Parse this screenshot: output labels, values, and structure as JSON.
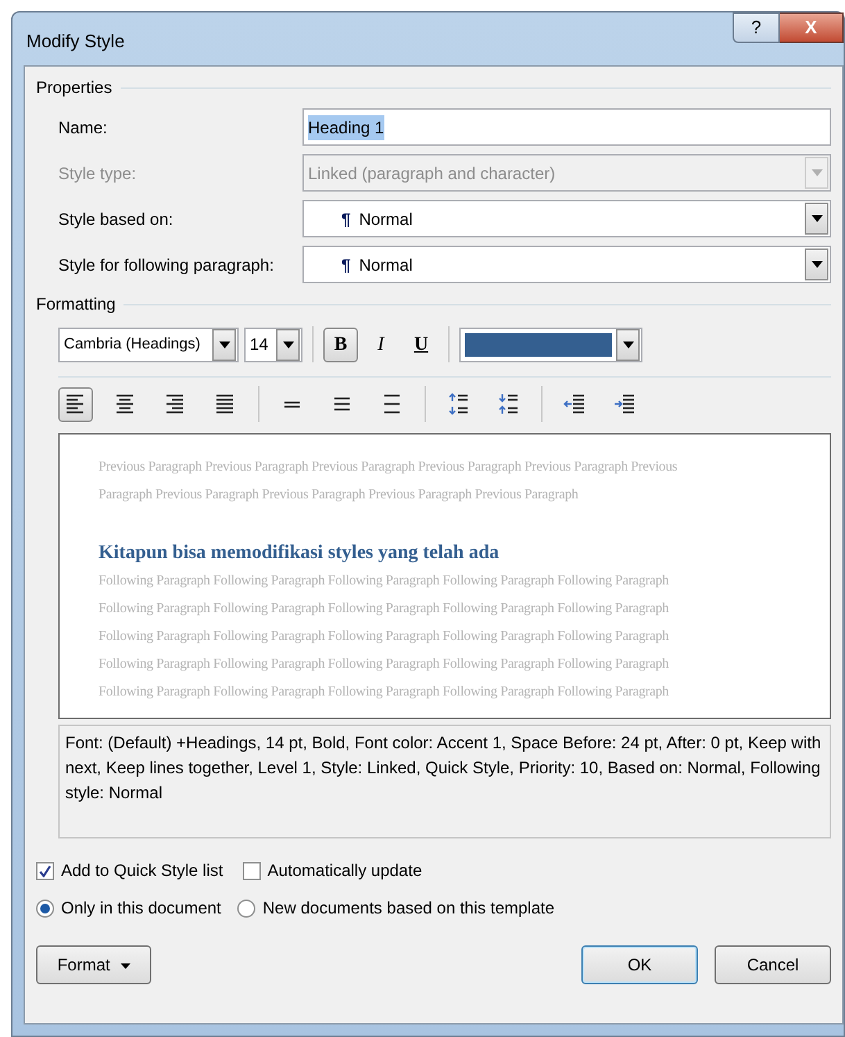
{
  "window": {
    "title": "Modify Style",
    "help_button": "?",
    "close_button": "X"
  },
  "properties": {
    "heading": "Properties",
    "fields": [
      {
        "label": "Name:",
        "kind": "text",
        "value": "Heading 1",
        "disabled": false,
        "selected": true
      },
      {
        "label": "Style type:",
        "kind": "combo",
        "value": "Linked (paragraph and character)",
        "disabled": true
      },
      {
        "label": "Style based on:",
        "kind": "combo",
        "mark": "¶",
        "value": "Normal",
        "disabled": false
      },
      {
        "label": "Style for following paragraph:",
        "kind": "combo",
        "mark": "¶",
        "value": "Normal",
        "disabled": false
      }
    ]
  },
  "formatting": {
    "heading": "Formatting",
    "font": "Cambria (Headings)",
    "size": "14",
    "font_color": {
      "color": "#345f90"
    },
    "style_buttons": [
      {
        "label": "B",
        "kind": "bold",
        "selected": true
      },
      {
        "label": "I",
        "kind": "italic",
        "selected": false
      },
      {
        "label": "U",
        "kind": "underline",
        "selected": false
      }
    ],
    "paragraph_buttons": [
      {
        "kind": "align-left",
        "selected": true
      },
      {
        "kind": "align-center",
        "selected": false
      },
      {
        "kind": "align-right",
        "selected": false
      },
      {
        "kind": "justify",
        "selected": false
      },
      {
        "kind": "sep"
      },
      {
        "kind": "single",
        "selected": false
      },
      {
        "kind": "one-half",
        "selected": false
      },
      {
        "kind": "double",
        "selected": false
      },
      {
        "kind": "sep"
      },
      {
        "kind": "space-up",
        "selected": false
      },
      {
        "kind": "space-down",
        "selected": false
      },
      {
        "kind": "sep"
      },
      {
        "kind": "outdent",
        "selected": false
      },
      {
        "kind": "indent",
        "selected": false
      }
    ]
  },
  "preview": {
    "previous": [
      "Previous Paragraph Previous Paragraph Previous Paragraph Previous Paragraph Previous Paragraph Previous",
      "Paragraph Previous Paragraph Previous Paragraph Previous Paragraph Previous Paragraph"
    ],
    "heading": "Kitapun bisa memodifikasi styles yang telah ada",
    "following": [
      "Following Paragraph Following Paragraph Following Paragraph Following Paragraph Following Paragraph",
      "Following Paragraph Following Paragraph Following Paragraph Following Paragraph Following Paragraph",
      "Following Paragraph Following Paragraph Following Paragraph Following Paragraph Following Paragraph",
      "Following Paragraph Following Paragraph Following Paragraph Following Paragraph Following Paragraph",
      "Following Paragraph Following Paragraph Following Paragraph Following Paragraph Following Paragraph"
    ]
  },
  "description": "Font: (Default) +Headings, 14 pt, Bold, Font color: Accent 1, Space Before:  24 pt, After:  0 pt, Keep with next, Keep lines together, Level 1, Style: Linked, Quick Style, Priority: 10, Based on: Normal, Following style: Normal",
  "checkboxes": [
    {
      "label": "Add to Quick Style list",
      "checked": true
    },
    {
      "label": "Automatically update",
      "checked": false
    }
  ],
  "radios": [
    {
      "label": "Only in this document",
      "selected": true
    },
    {
      "label": "New documents based on this template",
      "selected": false
    }
  ],
  "buttons": [
    {
      "label": "Format",
      "kind": "menu"
    },
    {
      "label": "OK",
      "kind": "default"
    },
    {
      "label": "Cancel",
      "kind": "normal"
    }
  ]
}
